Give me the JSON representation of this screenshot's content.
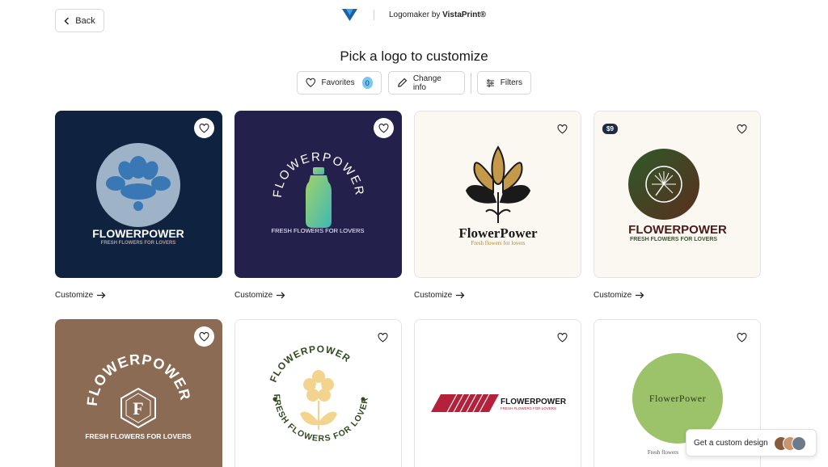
{
  "header": {
    "back_label": "Back",
    "brand_text": "Logomaker",
    "brand_by": "by",
    "brand_company": "VistaPrint®"
  },
  "page": {
    "title": "Pick a logo to customize"
  },
  "toolbar": {
    "favorites_label": "Favorites",
    "favorites_count": "0",
    "change_info_label": "Change info",
    "filters_label": "Filters"
  },
  "logos": [
    {
      "name": "FLOWERPOWER",
      "tagline": "FRESH FLOWERS FOR LOVERS",
      "bg": "#0f2340",
      "customize_label": "Customize"
    },
    {
      "name": "FLOWERPOWER",
      "tagline": "FRESH FLOWERS FOR LOVERS",
      "bg": "#23214b",
      "customize_label": "Customize"
    },
    {
      "name": "FlowerPower",
      "tagline": "Fresh flowers for lovers",
      "bg": "#fbf8f1",
      "customize_label": "Customize"
    },
    {
      "name": "FLOWERPOWER",
      "tagline": "FRESH FLOWERS FOR LOVERS",
      "bg": "#fbf8f1",
      "price": "$9",
      "customize_label": "Customize"
    },
    {
      "name": "FLOWERPOWER",
      "tagline": "FRESH FLOWERS FOR LOVERS",
      "bg": "#8b6b54"
    },
    {
      "name": "FLOWERPOWER",
      "tagline": "FRESH FLOWERS FOR LOVERS",
      "bg": "#ffffff"
    },
    {
      "name": "FLOWERPOWER",
      "tagline": "FRESH FLOWERS FOR LOVERS",
      "bg": "#ffffff"
    },
    {
      "name": "FlowerPower",
      "tagline": "Fresh flowers",
      "bg": "#ffffff"
    }
  ],
  "custom_design": {
    "label": "Get a custom design"
  },
  "colors": {
    "accent_badge": "#78c7f0",
    "price_badge": "#1f2a44"
  }
}
